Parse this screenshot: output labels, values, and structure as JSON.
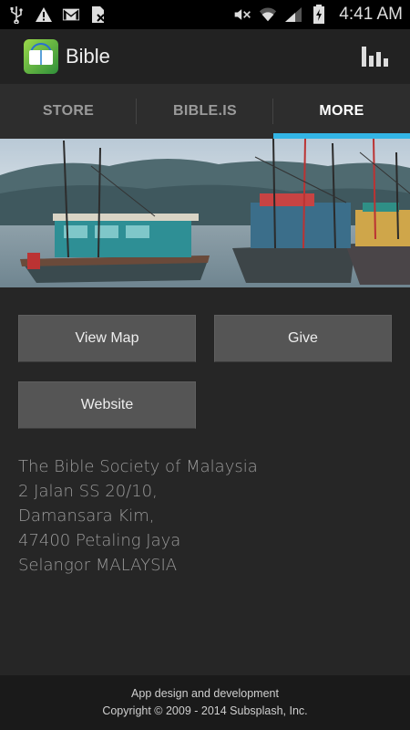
{
  "status_bar": {
    "time": "4:41 AM",
    "left_icons": [
      "usb-icon",
      "warning-icon",
      "gmail-icon",
      "file-cancel-icon"
    ],
    "right_icons": [
      "mute-icon",
      "wifi-icon",
      "signal-icon",
      "battery-icon"
    ]
  },
  "app_bar": {
    "title": "Bible",
    "logo_icon": "bible-app-logo",
    "action_icon": "bar-chart-icon"
  },
  "tabs": [
    {
      "label": "STORE",
      "active": false
    },
    {
      "label": "BIBLE.IS",
      "active": false
    },
    {
      "label": "MORE",
      "active": true
    }
  ],
  "accent_color": "#33b5e5",
  "buttons": {
    "view_map": "View Map",
    "give": "Give",
    "website": "Website"
  },
  "address": {
    "lines": [
      "The Bible Society of Malaysia",
      "2 Jalan SS 20/10,",
      "Damansara Kim,",
      "47400 Petaling Jaya",
      "Selangor MALAYSIA"
    ]
  },
  "footer": {
    "line1": "App design and development",
    "line2": "Copyright © 2009 - 2014 Subsplash, Inc."
  }
}
